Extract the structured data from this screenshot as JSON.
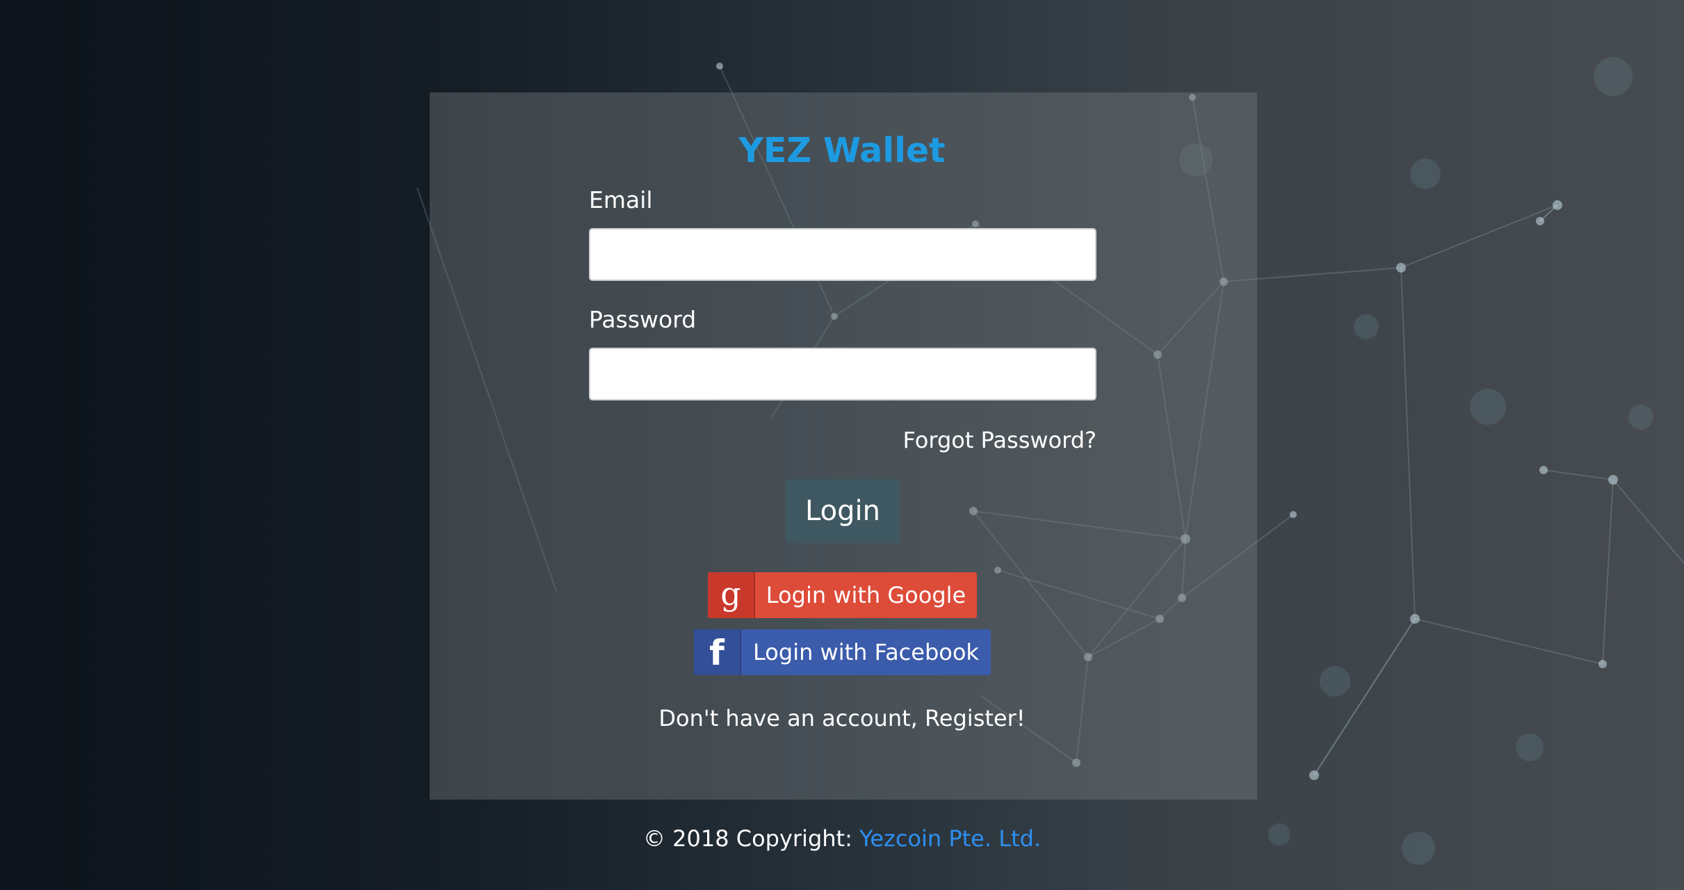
{
  "app": {
    "title": "YEZ Wallet"
  },
  "form": {
    "email_label": "Email",
    "email_value": "",
    "password_label": "Password",
    "password_value": "",
    "forgot_password": "Forgot Password?",
    "login_label": "Login"
  },
  "social": {
    "google_label": "Login with Google",
    "google_icon": "google-g-icon",
    "facebook_label": "Login with Facebook",
    "facebook_icon": "facebook-f-icon"
  },
  "register": {
    "text": "Don't have an account, Register!"
  },
  "footer": {
    "copyright": "© 2018 Copyright:",
    "company_link": "Yezcoin Pte. Ltd."
  },
  "colors": {
    "title": "#1d9be2",
    "login_button": "#3f5861",
    "google": "#dd4b39",
    "facebook": "#3b5bab",
    "link": "#2f8ff0"
  }
}
